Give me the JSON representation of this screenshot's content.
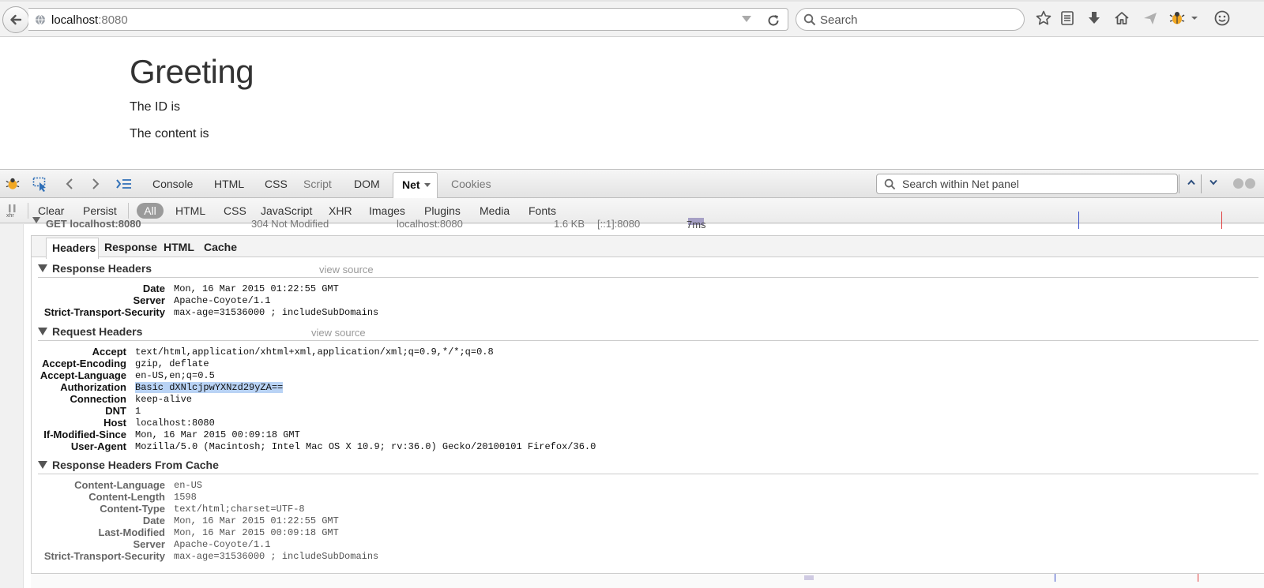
{
  "browser": {
    "url_host": "localhost",
    "url_port": ":8080",
    "search_placeholder": "Search",
    "icons": [
      "back-arrow-icon",
      "globe-icon",
      "dropdown-arrow-icon",
      "reload-icon",
      "search-icon",
      "bookmark-star-icon",
      "reading-list-icon",
      "download-icon",
      "home-icon",
      "share-icon",
      "firebug-icon",
      "chevron-down-icon",
      "smiley-icon"
    ]
  },
  "page": {
    "title": "Greeting",
    "id_line": "The ID is",
    "content_line": "The content is"
  },
  "firebug": {
    "tabs": {
      "console": "Console",
      "html": "HTML",
      "css": "CSS",
      "script": "Script",
      "dom": "DOM",
      "net": "Net",
      "cookies": "Cookies"
    },
    "search_placeholder": "Search within Net panel",
    "toolbar2": {
      "clear": "Clear",
      "persist": "Persist",
      "filters": [
        "All",
        "HTML",
        "CSS",
        "JavaScript",
        "XHR",
        "Images",
        "Plugins",
        "Media",
        "Fonts"
      ]
    },
    "request": {
      "method_url": "GET localhost:8080",
      "status": "304 Not Modified",
      "domain": "localhost:8080",
      "size": "1.6 KB",
      "remote_ip": "[::1]:8080",
      "time": "7ms"
    },
    "detail_tabs": [
      "Headers",
      "Response",
      "HTML",
      "Cache"
    ],
    "sections": {
      "response_headers": {
        "title": "Response Headers",
        "view_source": "view source",
        "rows": [
          {
            "name": "Date",
            "value": "Mon, 16 Mar 2015 01:22:55 GMT"
          },
          {
            "name": "Server",
            "value": "Apache-Coyote/1.1"
          },
          {
            "name": "Strict-Transport-Security",
            "value": "max-age=31536000 ; includeSubDomains"
          }
        ]
      },
      "request_headers": {
        "title": "Request Headers",
        "view_source": "view source",
        "rows": [
          {
            "name": "Accept",
            "value": "text/html,application/xhtml+xml,application/xml;q=0.9,*/*;q=0.8"
          },
          {
            "name": "Accept-Encoding",
            "value": "gzip, deflate"
          },
          {
            "name": "Accept-Language",
            "value": "en-US,en;q=0.5"
          },
          {
            "name": "Authorization",
            "value": "Basic dXNlcjpwYXNzd29yZA=="
          },
          {
            "name": "Connection",
            "value": "keep-alive"
          },
          {
            "name": "DNT",
            "value": "1"
          },
          {
            "name": "Host",
            "value": "localhost:8080"
          },
          {
            "name": "If-Modified-Since",
            "value": "Mon, 16 Mar 2015 00:09:18 GMT"
          },
          {
            "name": "User-Agent",
            "value": "Mozilla/5.0 (Macintosh; Intel Mac OS X 10.9; rv:36.0) Gecko/20100101 Firefox/36.0"
          }
        ]
      },
      "cache_headers": {
        "title": "Response Headers From Cache",
        "rows": [
          {
            "name": "Content-Language",
            "value": "en-US"
          },
          {
            "name": "Content-Length",
            "value": "1598"
          },
          {
            "name": "Content-Type",
            "value": "text/html;charset=UTF-8"
          },
          {
            "name": "Date",
            "value": "Mon, 16 Mar 2015 01:22:55 GMT"
          },
          {
            "name": "Last-Modified",
            "value": "Mon, 16 Mar 2015 00:09:18 GMT"
          },
          {
            "name": "Server",
            "value": "Apache-Coyote/1.1"
          },
          {
            "name": "Strict-Transport-Security",
            "value": "max-age=31536000 ; includeSubDomains"
          }
        ]
      }
    },
    "colors": {
      "selection": "#b9d3f5",
      "timeline_bar": "#a6a0c5",
      "dom_loaded_line": "#3a4fc8",
      "load_line": "#e04040"
    }
  }
}
